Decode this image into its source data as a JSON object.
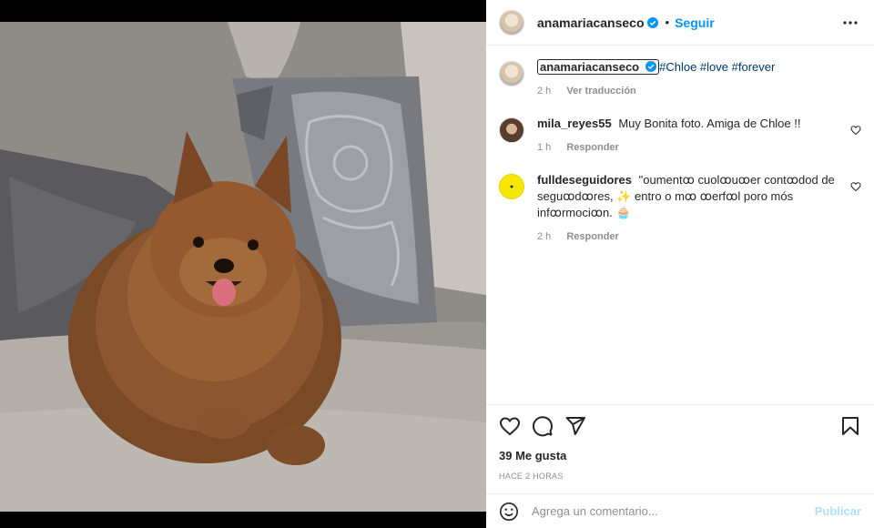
{
  "post": {
    "author": "anamariacanseco",
    "follow_label": "Seguir",
    "dot": "•"
  },
  "caption": {
    "username": "anamariacanseco",
    "hashtags": "#Chloe #love #forever",
    "time": "2 h",
    "translate_label": "Ver traducción"
  },
  "comments": [
    {
      "username": "mila_reyes55",
      "text": "Muy Bonita foto. Amiga de Chloe !!",
      "time": "1 h",
      "reply_label": "Responder"
    },
    {
      "username": "fulldeseguidores",
      "text": "\"oumentꝏ cuolꝏuꝏer contꝏdod de seguꝏdꝏres, ✨ entro o mꝏ ꝏerfꝏl poro mós infꝏrmociꝏn. 🧁",
      "time": "2 h",
      "reply_label": "Responder"
    }
  ],
  "stats": {
    "likes": "39 Me gusta",
    "posted": "HACE 2 HORAS"
  },
  "composer": {
    "placeholder": "Agrega un comentario...",
    "publish_label": "Publicar"
  },
  "icons": {
    "more": "more-icon",
    "like": "heart-icon",
    "comment": "comment-icon",
    "share": "share-icon",
    "save": "bookmark-icon",
    "emoji": "emoji-icon",
    "verified": "verified-badge-icon"
  },
  "colors": {
    "accent": "#0095f6",
    "publish_disabled": "#b2dffc",
    "hashtag": "#00376b",
    "muted": "#8e8e8e"
  }
}
